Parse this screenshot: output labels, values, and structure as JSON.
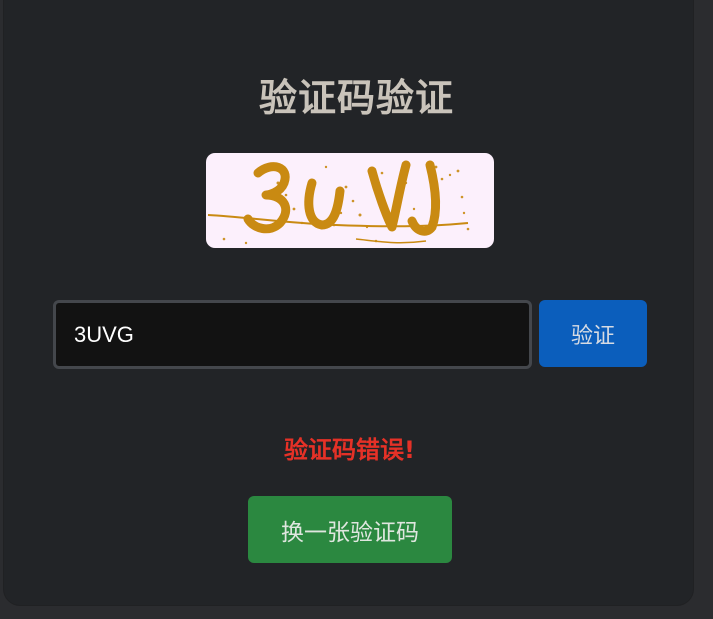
{
  "page": {
    "title": "验证码验证"
  },
  "captcha": {
    "image_text": "3UVJ"
  },
  "form": {
    "input_value": "3UVG",
    "verify_label": "验证"
  },
  "message": {
    "error": "验证码错误!"
  },
  "actions": {
    "refresh_label": "换一张验证码"
  },
  "colors": {
    "background": "#222427",
    "title": "#c9c3ba",
    "verify_button": "#0b5ebc",
    "refresh_button": "#2b8840",
    "error": "#e53127",
    "captcha_background": "#fcf0fc",
    "captcha_glyphs": "#c98a12"
  }
}
